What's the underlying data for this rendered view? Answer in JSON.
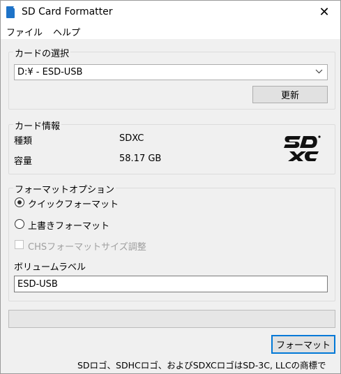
{
  "window": {
    "title": "SD Card Formatter",
    "close_glyph": "✕"
  },
  "menu": {
    "items": [
      "ファイル",
      "ヘルプ"
    ]
  },
  "card_select": {
    "group_label": "カードの選択",
    "selected_drive": "D:¥ - ESD-USB",
    "refresh_label": "更新"
  },
  "card_info": {
    "group_label": "カード情報",
    "type_label": "種類",
    "type_value": "SDXC",
    "capacity_label": "容量",
    "capacity_value": "58.17 GB",
    "logo": "sdxc-logo"
  },
  "format_options": {
    "group_label": "フォーマットオプション",
    "quick_format": "クイックフォーマット",
    "quick_selected": true,
    "overwrite_format": "上書きフォーマット",
    "overwrite_selected": false,
    "chs_label": "CHSフォーマットサイズ調整",
    "chs_checked": false,
    "volume_label_title": "ボリュームラベル",
    "volume_label_value": "ESD-USB"
  },
  "progress": {
    "fraction": 0
  },
  "format_button_label": "フォーマット",
  "footer_note": "SDロゴ、SDHCロゴ、およびSDXCロゴはSD-3C, LLCの商標です。"
}
